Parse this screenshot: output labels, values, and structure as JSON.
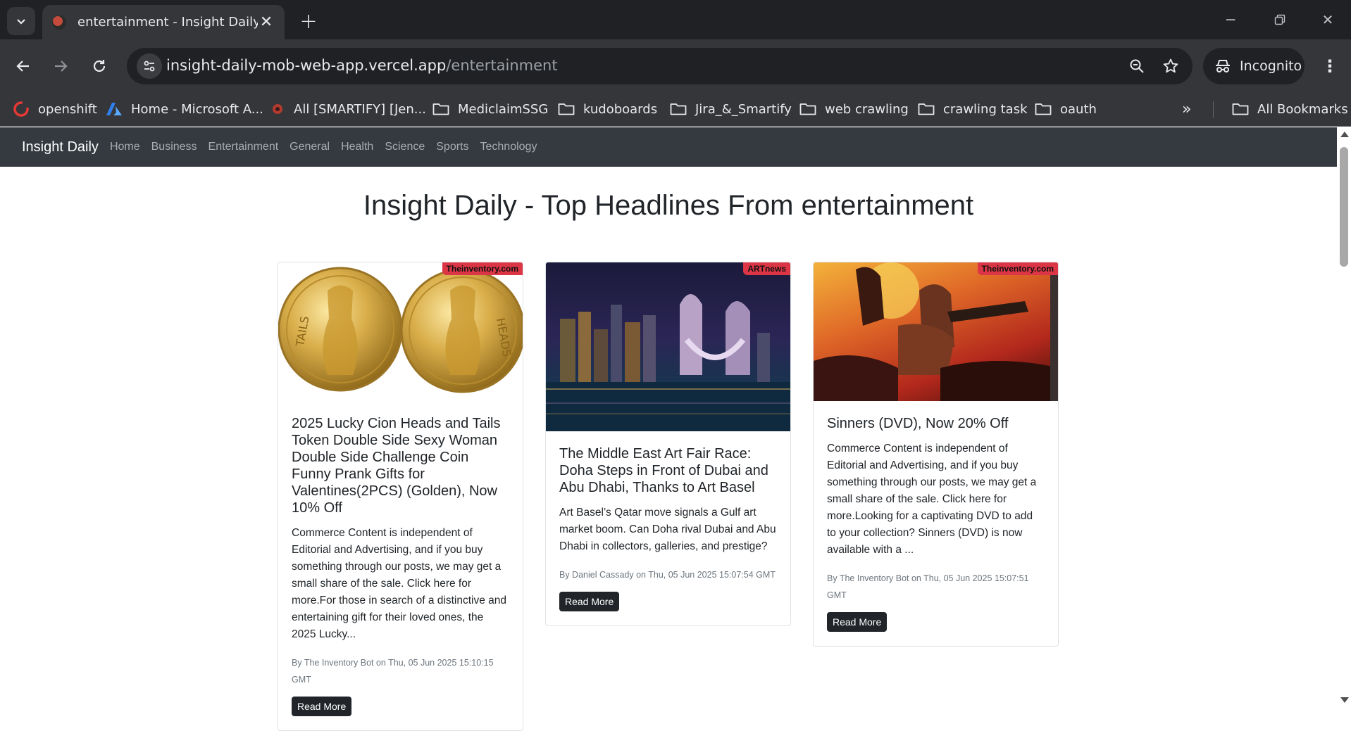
{
  "browser": {
    "tab_title": "entertainment - Insight Daily",
    "url_host": "insight-daily-mob-web-app.vercel.app",
    "url_path": "/entertainment",
    "incognito_label": "Incognito",
    "bookmarks": [
      {
        "label": "openshift",
        "icon": "openshift-icon"
      },
      {
        "label": "Home - Microsoft A...",
        "icon": "azure-icon"
      },
      {
        "label": "All [SMARTIFY] [Jen...",
        "icon": "jenkins-icon"
      },
      {
        "label": "MediclaimSSG",
        "icon": "folder-icon"
      },
      {
        "label": "kudoboards",
        "icon": "folder-icon"
      },
      {
        "label": "Jira_&_Smartify",
        "icon": "folder-icon"
      },
      {
        "label": "web crawling",
        "icon": "folder-icon"
      },
      {
        "label": "crawling task",
        "icon": "folder-icon"
      },
      {
        "label": "oauth",
        "icon": "folder-icon"
      }
    ],
    "all_bookmarks_label": "All Bookmarks"
  },
  "site": {
    "brand": "Insight Daily",
    "nav": [
      "Home",
      "Business",
      "Entertainment",
      "General",
      "Health",
      "Science",
      "Sports",
      "Technology"
    ],
    "heading": "Insight Daily - Top Headlines From entertainment"
  },
  "articles": [
    {
      "source": "Theinventory.com",
      "title": "2025 Lucky Cion Heads and Tails Token Double Side Sexy Woman Double Side Challenge Coin Funny Prank Gifts for Valentines(2PCS) (Golden), Now 10% Off",
      "description": "Commerce Content is independent of Editorial and Advertising, and if you buy something through our posts, we may get a small share of the sale. Click here for more.For those in search of a distinctive and entertaining gift for their loved ones, the 2025 Lucky...",
      "meta": "By The Inventory Bot on Thu, 05 Jun 2025 15:10:15 GMT",
      "button": "Read More"
    },
    {
      "source": "ARTnews",
      "title": "The Middle East Art Fair Race: Doha Steps in Front of Dubai and Abu Dhabi, Thanks to Art Basel",
      "description": "Art Basel’s Qatar move signals a Gulf art market boom. Can Doha rival Dubai and Abu Dhabi in collectors, galleries, and prestige?",
      "meta": "By Daniel Cassady on Thu, 05 Jun 2025 15:07:54 GMT",
      "button": "Read More"
    },
    {
      "source": "Theinventory.com",
      "title": "Sinners (DVD), Now 20% Off",
      "description": "Commerce Content is independent of Editorial and Advertising, and if you buy something through our posts, we may get a small share of the sale. Click here for more.Looking for a captivating DVD to add to your collection? Sinners (DVD) is now available with a ...",
      "meta": "By The Inventory Bot on Thu, 05 Jun 2025 15:07:51 GMT",
      "button": "Read More"
    }
  ]
}
